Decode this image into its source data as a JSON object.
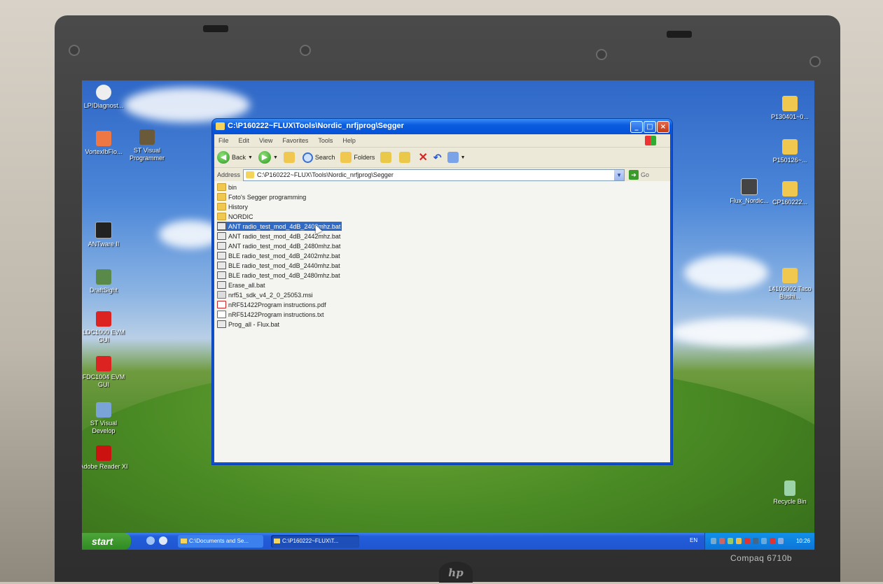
{
  "desktop": {
    "left_icons": [
      {
        "label": "LPIDiagnost..."
      },
      {
        "label": "VortexIbFlo..."
      },
      {
        "label": "ST Visual Programmer"
      },
      {
        "label": "ANTware II"
      },
      {
        "label": "DraftSight"
      },
      {
        "label": "LDC1000 EVM GUI"
      },
      {
        "label": "FDC1004 EVM GUI"
      },
      {
        "label": "ST Visual Develop"
      },
      {
        "label": "Adobe Reader XI"
      }
    ],
    "right_icons": [
      {
        "label": "P130401~0..."
      },
      {
        "label": "P150126~..."
      },
      {
        "label": "Flux_Nordic..."
      },
      {
        "label": "CP160222..."
      },
      {
        "label": "14103002 Taco Bushi..."
      },
      {
        "label": "Recycle Bin"
      }
    ]
  },
  "window": {
    "title": "C:\\P160222~FLUX\\Tools\\Nordic_nrfjprog\\Segger",
    "menu": [
      "File",
      "Edit",
      "View",
      "Favorites",
      "Tools",
      "Help"
    ],
    "toolbar": {
      "back_label": "Back",
      "search_label": "Search",
      "folders_label": "Folders"
    },
    "address": {
      "label": "Address",
      "value": "C:\\P160222~FLUX\\Tools\\Nordic_nrfjprog\\Segger",
      "go_label": "Go"
    },
    "files": [
      {
        "name": "bin",
        "type": "folder",
        "selected": false
      },
      {
        "name": "Foto's Segger programming",
        "type": "folder",
        "selected": false
      },
      {
        "name": "History",
        "type": "folder",
        "selected": false
      },
      {
        "name": "NORDIC",
        "type": "folder",
        "selected": false
      },
      {
        "name": "ANT radio_test_mod_4dB_2403mhz.bat",
        "type": "bat",
        "selected": true
      },
      {
        "name": "ANT radio_test_mod_4dB_2442mhz.bat",
        "type": "bat",
        "selected": false
      },
      {
        "name": "ANT radio_test_mod_4dB_2480mhz.bat",
        "type": "bat",
        "selected": false
      },
      {
        "name": "BLE radio_test_mod_4dB_2402mhz.bat",
        "type": "bat",
        "selected": false
      },
      {
        "name": "BLE radio_test_mod_4dB_2440mhz.bat",
        "type": "bat",
        "selected": false
      },
      {
        "name": "BLE radio_test_mod_4dB_2480mhz.bat",
        "type": "bat",
        "selected": false
      },
      {
        "name": "Erase_all.bat",
        "type": "bat",
        "selected": false
      },
      {
        "name": "nrf51_sdk_v4_2_0_25053.msi",
        "type": "msi",
        "selected": false
      },
      {
        "name": "nRF51422Program instructions.pdf",
        "type": "pdf",
        "selected": false
      },
      {
        "name": "nRF51422Program instructions.txt",
        "type": "txt",
        "selected": false
      },
      {
        "name": "Prog_all - Flux.bat",
        "type": "bat",
        "selected": false
      }
    ]
  },
  "taskbar": {
    "start_label": "start",
    "tasks": [
      {
        "label": "C:\\Documents and Se..."
      },
      {
        "label": "C:\\P160222~FLUX\\T..."
      }
    ],
    "tray_lang": "EN",
    "clock": "10:26"
  },
  "laptop": {
    "brand": "hp",
    "model": "Compaq 6710b"
  },
  "colors": {
    "selection": "#316ac5",
    "titlebar": "#0a5ce0",
    "taskbar": "#245edb",
    "start_button": "#2e8a22"
  }
}
